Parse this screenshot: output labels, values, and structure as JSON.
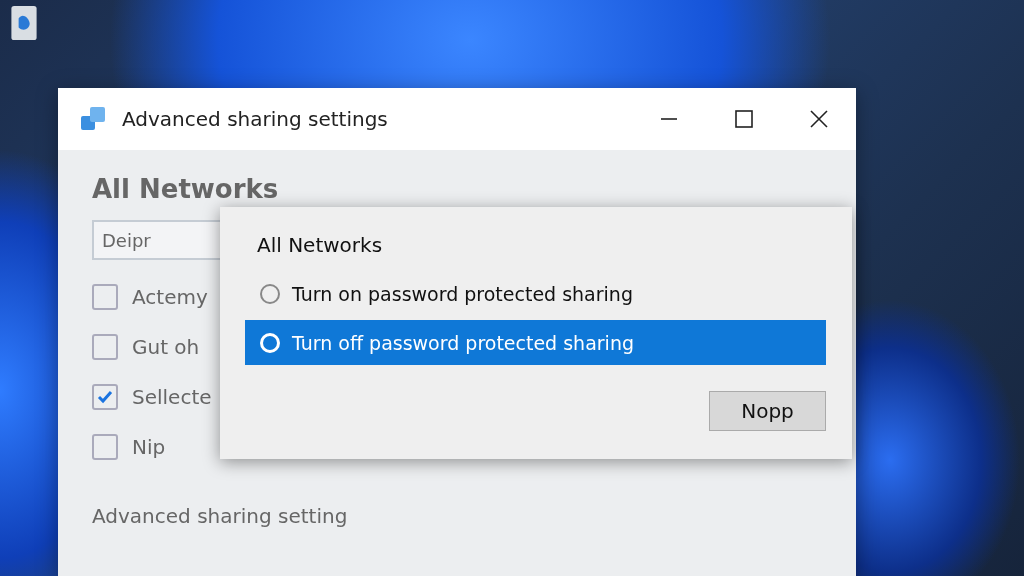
{
  "window": {
    "title": "Advanced sharing settings"
  },
  "background_page": {
    "heading": "All Networks",
    "field_value": "Deipr",
    "checkboxes": [
      {
        "label": "Actemy",
        "checked": false
      },
      {
        "label": "Gut oh",
        "checked": false
      },
      {
        "label": "Sellecte",
        "checked": true
      },
      {
        "label": "Nip",
        "checked": false
      }
    ],
    "footer": "Advanced sharing setting"
  },
  "dialog": {
    "heading": "All Networks",
    "options": [
      {
        "label": "Turn on password protected sharing",
        "selected": false
      },
      {
        "label": "Turn off password protected sharing",
        "selected": true
      }
    ],
    "button": "Nopp"
  }
}
